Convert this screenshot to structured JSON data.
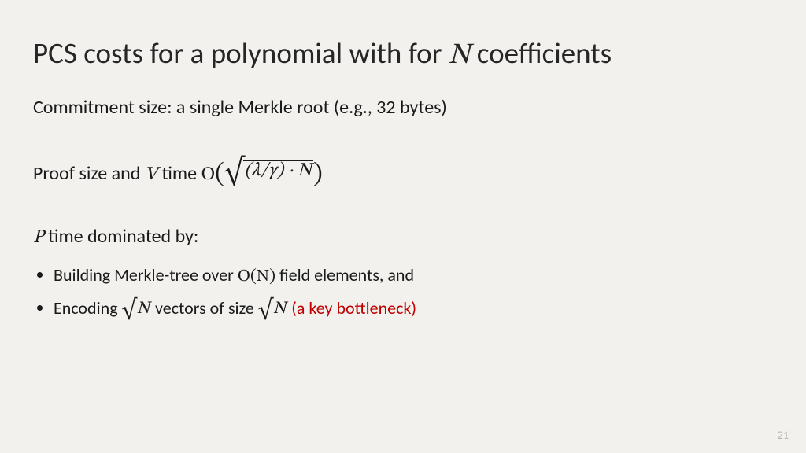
{
  "title_pre": "PCS costs for a polynomial with for ",
  "title_var": "N",
  "title_post": " coefficients",
  "commitment": "Commitment size: a single Merkle root (e.g., 32 bytes)",
  "proof_pre": "Proof size and ",
  "proof_var": "V",
  "proof_mid": " time ",
  "bigO_letter": "O",
  "sqrt_inner_expr": "(λ/γ) · N",
  "ptime_var": "P",
  "ptime_post": " time dominated by:",
  "bullet1_pre": "Building Merkle-tree over ",
  "bullet1_bigO": "O(N)",
  "bullet1_post": " field elements, and",
  "bullet2_pre": "Encoding ",
  "sqrtN": "N",
  "bullet2_mid": " vectors of size ",
  "bullet2_red": "(a key bottleneck)",
  "page_number": "21"
}
